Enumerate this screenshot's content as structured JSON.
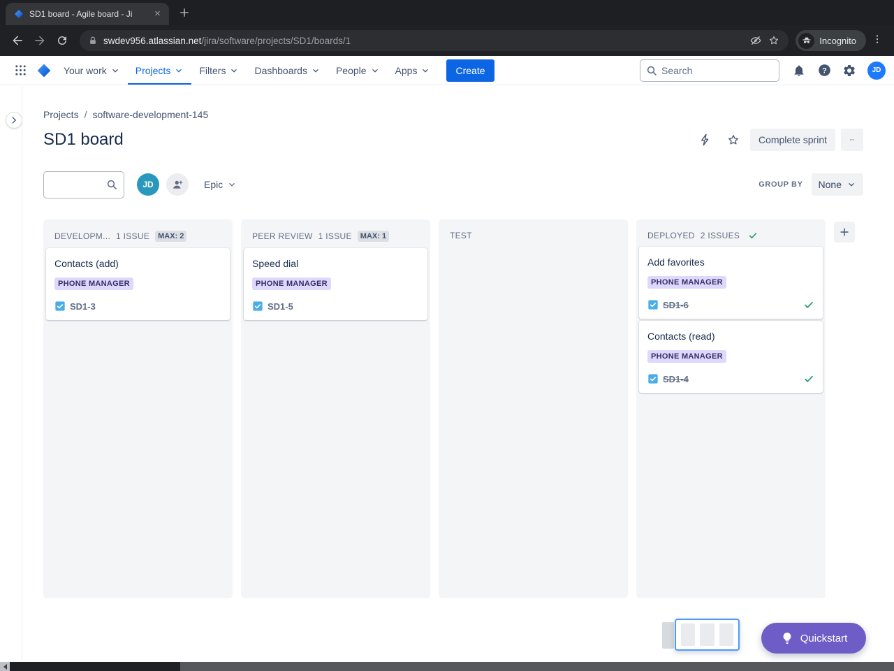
{
  "browser": {
    "tab_title": "SD1 board - Agile board - Ji",
    "url_host": "swdev956.atlassian.net",
    "url_path": "/jira/software/projects/SD1/boards/1",
    "incognito_label": "Incognito"
  },
  "nav": {
    "items": [
      {
        "label": "Your work"
      },
      {
        "label": "Projects"
      },
      {
        "label": "Filters"
      },
      {
        "label": "Dashboards"
      },
      {
        "label": "People"
      },
      {
        "label": "Apps"
      }
    ],
    "create_label": "Create",
    "search_placeholder": "Search",
    "avatar_initials": "JD"
  },
  "header": {
    "breadcrumbs": [
      "Projects",
      "software-development-145"
    ],
    "separator": "/",
    "title": "SD1 board",
    "complete_sprint_label": "Complete sprint"
  },
  "controls": {
    "avatar_initials": "JD",
    "epic_filter_label": "Epic",
    "group_by_label": "GROUP BY",
    "group_by_value": "None"
  },
  "board": {
    "columns": [
      {
        "name": "DEVELOPM...",
        "count": "1 ISSUE",
        "max_badge": "MAX: 2",
        "cards": [
          {
            "summary": "Contacts (add)",
            "epic_label": "PHONE MANAGER",
            "key": "SD1-3",
            "done": false
          }
        ]
      },
      {
        "name": "PEER REVIEW",
        "count": "1 ISSUE",
        "max_badge": "MAX: 1",
        "cards": [
          {
            "summary": "Speed dial",
            "epic_label": "PHONE MANAGER",
            "key": "SD1-5",
            "done": false
          }
        ]
      },
      {
        "name": "TEST",
        "cards": []
      },
      {
        "name": "DEPLOYED",
        "count": "2 ISSUES",
        "done": true,
        "cards": [
          {
            "summary": "Add favorites",
            "epic_label": "PHONE MANAGER",
            "key": "SD1-6",
            "done": true
          },
          {
            "summary": "Contacts (read)",
            "epic_label": "PHONE MANAGER",
            "key": "SD1-4",
            "done": true
          }
        ]
      }
    ]
  },
  "footer": {
    "quickstart_label": "Quickstart"
  },
  "colors": {
    "brand_blue": "#0C66E4",
    "epic_purple_bg": "#DFD8FD",
    "epic_purple_text": "#352C63",
    "done_green": "#22A06B",
    "task_blue": "#4BADE8",
    "quickstart_purple": "#6E5DC6"
  }
}
